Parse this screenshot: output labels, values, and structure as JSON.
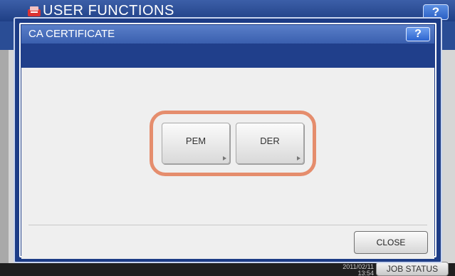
{
  "background": {
    "title": "USER FUNCTIONS",
    "help_label": "?",
    "logo_icon": "user-functions-logo-icon",
    "clock": [
      "2011/02/11",
      "13:54"
    ],
    "job_status_label": "JOB STATUS"
  },
  "dialog": {
    "title": "CA CERTIFICATE",
    "help_label": "?",
    "buttons": [
      {
        "label": "PEM"
      },
      {
        "label": "DER"
      }
    ],
    "close_label": "CLOSE"
  },
  "colors": {
    "title_bar": "#1f3f85",
    "highlight_outline": "#e58d6d",
    "content_bg": "#efefef"
  }
}
